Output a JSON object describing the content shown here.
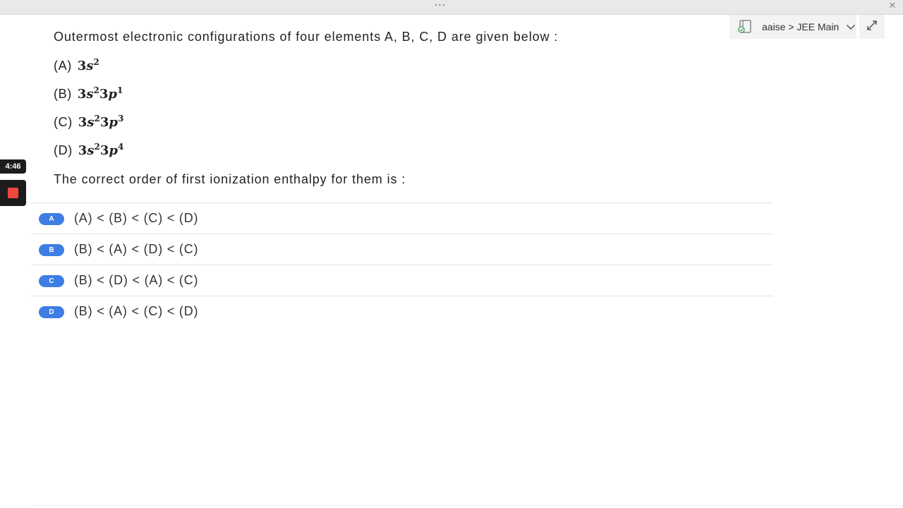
{
  "window": {
    "menu_dots": "···",
    "close_glyph": "✕"
  },
  "notebook": {
    "breadcrumb": "aaise > JEE Main"
  },
  "recording": {
    "timer": "4:46"
  },
  "question": {
    "intro": "Outermost electronic configurations of four elements A, B, C, D are given below :",
    "configs": [
      {
        "label": "(A)",
        "n1": "3",
        "o1": "s",
        "e1": "2",
        "n2": "",
        "o2": "",
        "e2": ""
      },
      {
        "label": "(B)",
        "n1": "3",
        "o1": "s",
        "e1": "2",
        "n2": "3",
        "o2": "p",
        "e2": "1"
      },
      {
        "label": "(C)",
        "n1": "3",
        "o1": "s",
        "e1": "2",
        "n2": "3",
        "o2": "p",
        "e2": "3"
      },
      {
        "label": "(D)",
        "n1": "3",
        "o1": "s",
        "e1": "2",
        "n2": "3",
        "o2": "p",
        "e2": "4"
      }
    ],
    "stem": "The correct order of first ionization enthalpy for them is :"
  },
  "options": [
    {
      "badge": "A",
      "text": "(A) < (B) < (C) < (D)"
    },
    {
      "badge": "B",
      "text": "(B) < (A) < (D) < (C)"
    },
    {
      "badge": "C",
      "text": "(B) < (D) < (A) < (C)"
    },
    {
      "badge": "D",
      "text": "(B) < (A) < (C) < (D)"
    }
  ],
  "colors": {
    "badge": "#3d7de4",
    "stop": "#f0473c"
  }
}
